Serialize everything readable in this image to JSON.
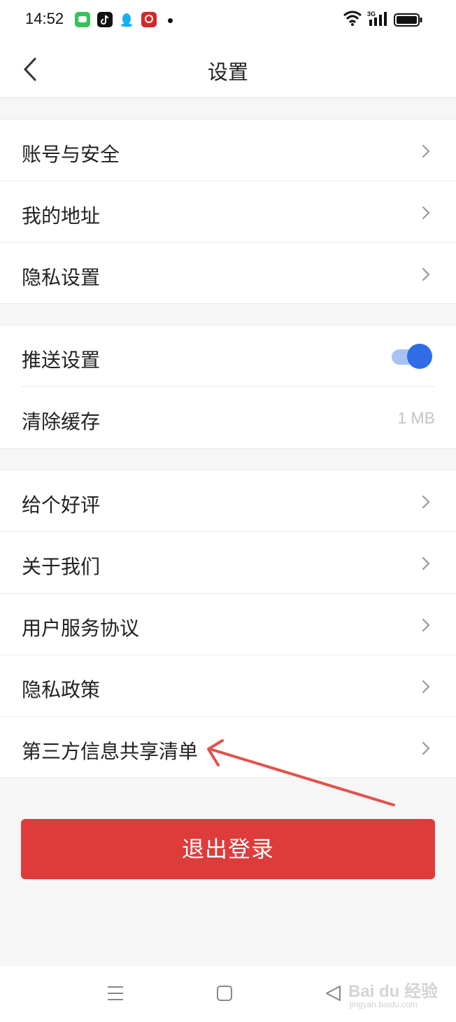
{
  "status_bar": {
    "time": "14:52",
    "network_label": "3G"
  },
  "header": {
    "title": "设置",
    "back_icon": "chevron-left-icon"
  },
  "groups": [
    {
      "items": [
        {
          "label": "账号与安全",
          "icon": "chevron-right-icon"
        },
        {
          "label": "我的地址",
          "icon": "chevron-right-icon"
        },
        {
          "label": "隐私设置",
          "icon": "chevron-right-icon"
        }
      ]
    },
    {
      "items": [
        {
          "label": "推送设置",
          "toggle_on": true
        },
        {
          "label": "清除缓存",
          "value": "1 MB"
        }
      ]
    },
    {
      "items": [
        {
          "label": "给个好评",
          "icon": "chevron-right-icon"
        },
        {
          "label": "关于我们",
          "icon": "chevron-right-icon"
        },
        {
          "label": "用户服务协议",
          "icon": "chevron-right-icon"
        },
        {
          "label": "隐私政策",
          "icon": "chevron-right-icon"
        },
        {
          "label": "第三方信息共享清单",
          "icon": "chevron-right-icon"
        }
      ]
    }
  ],
  "logout_label": "退出登录",
  "nav_bar": {
    "icons": [
      "menu-icon",
      "home-square-icon",
      "back-triangle-icon"
    ]
  },
  "watermark": {
    "brand": "Bai du 经验",
    "site": "jingyan.baidu.com"
  },
  "colors": {
    "accent_blue": "#2f6ce5",
    "logout_red": "#de3b3b",
    "annotation_red": "#e2514c"
  }
}
